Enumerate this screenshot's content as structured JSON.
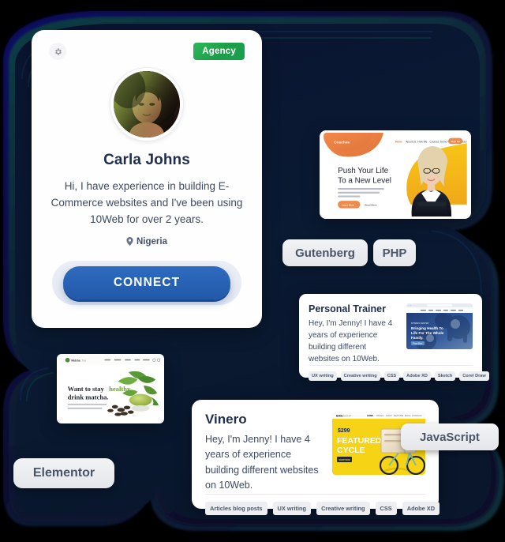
{
  "colors": {
    "background": "#000000",
    "blob_dark": "#0b1730",
    "blob_navy_ring": "#0a0f5c",
    "blob_teal_ring": "#0d4244",
    "accent_blue": "#2159a8",
    "accent_green": "#2eb85c",
    "card_white": "#ffffff",
    "pill_grey": "#e9ebee",
    "text_dark": "#1f2e4d",
    "text_body": "#3d4a63"
  },
  "profile_card": {
    "settings_icon": "gear-icon",
    "badge_label": "Agency",
    "avatar_alt": "avatar",
    "name": "Carla Johns",
    "bio": "Hi, I have experience in building E-Commerce websites and I've been using 10Web for over 2 years.",
    "location_icon": "map-pin-icon",
    "location": "Nigeria",
    "connect_label": "CONNECT"
  },
  "pills": [
    {
      "id": "gutenberg",
      "label": "Gutenberg"
    },
    {
      "id": "php",
      "label": "PHP"
    },
    {
      "id": "javascript",
      "label": "JavaScript"
    },
    {
      "id": "elementor",
      "label": "Elementor"
    }
  ],
  "site_previews": {
    "coaching": {
      "brand": "Coaches",
      "nav": [
        "Home",
        "About Us",
        "How We",
        "Courses",
        "Demo",
        "Webinar",
        "Contact"
      ],
      "cta": "Sign Up",
      "headline_line1": "Push Your Life",
      "headline_line2": "To a New Level",
      "button_primary": "Learn More",
      "button_secondary": "Read More"
    },
    "matcha": {
      "brand": "Matcha Tea",
      "nav": [
        "Home",
        "Shop",
        "About",
        "Blog",
        "Pages",
        "Contact"
      ],
      "headline_pre": "Want to stay ",
      "headline_accent": "healthy",
      "headline_line2": "drink matcha."
    }
  },
  "portfolio_cards": [
    {
      "id": "personal-trainer",
      "title": "Personal Trainer",
      "description": "Hey, I'm Jenny! I have 4 years of experience building different websites on 10Web.",
      "thumb_headline": "Bringing Health To Life For The Whole Family.",
      "thumb_button": "Read More",
      "tags": [
        "UX writing",
        "Creative writing",
        "CSS",
        "Adobe XD",
        "Sketch",
        "Corel Draw"
      ]
    },
    {
      "id": "vinero",
      "title": "Vinero",
      "description": "Hey, I'm Jenny! I have 4 years of experience building different websites on 10Web.",
      "thumb_brand": "BIKESHOP",
      "thumb_price": "$299",
      "thumb_headline_line1": "FEATURED",
      "thumb_headline_line2": "CYCLE",
      "thumb_button": "SHOP NOW",
      "tags": [
        "Articles blog posts",
        "UX writing",
        "Creative writing",
        "CSS",
        "Adobe XD"
      ]
    }
  ]
}
